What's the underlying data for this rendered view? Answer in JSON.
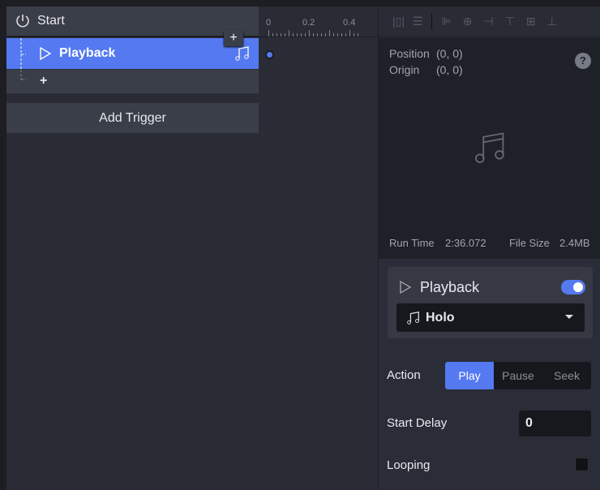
{
  "triggers": {
    "start_label": "Start",
    "child": {
      "label": "Playback"
    },
    "add_child": "+",
    "add_hover": "+",
    "add_trigger": "Add Trigger"
  },
  "timeline": {
    "ticks": [
      "0",
      "0.2",
      "0.4"
    ]
  },
  "preview": {
    "position_label": "Position",
    "position_value": "(0, 0)",
    "origin_label": "Origin",
    "origin_value": "(0, 0)",
    "help": "?",
    "run_time_label": "Run Time",
    "run_time_value": "2:36.072",
    "file_size_label": "File Size",
    "file_size_value": "2.4MB"
  },
  "inspector": {
    "title": "Playback",
    "enabled": true,
    "audio": "Holo",
    "action_label": "Action",
    "actions": [
      "Play",
      "Pause",
      "Seek"
    ],
    "selected_action": "Play",
    "start_delay_label": "Start Delay",
    "start_delay_value": "0",
    "looping_label": "Looping",
    "looping": false
  },
  "colors": {
    "accent": "#5479f0"
  }
}
